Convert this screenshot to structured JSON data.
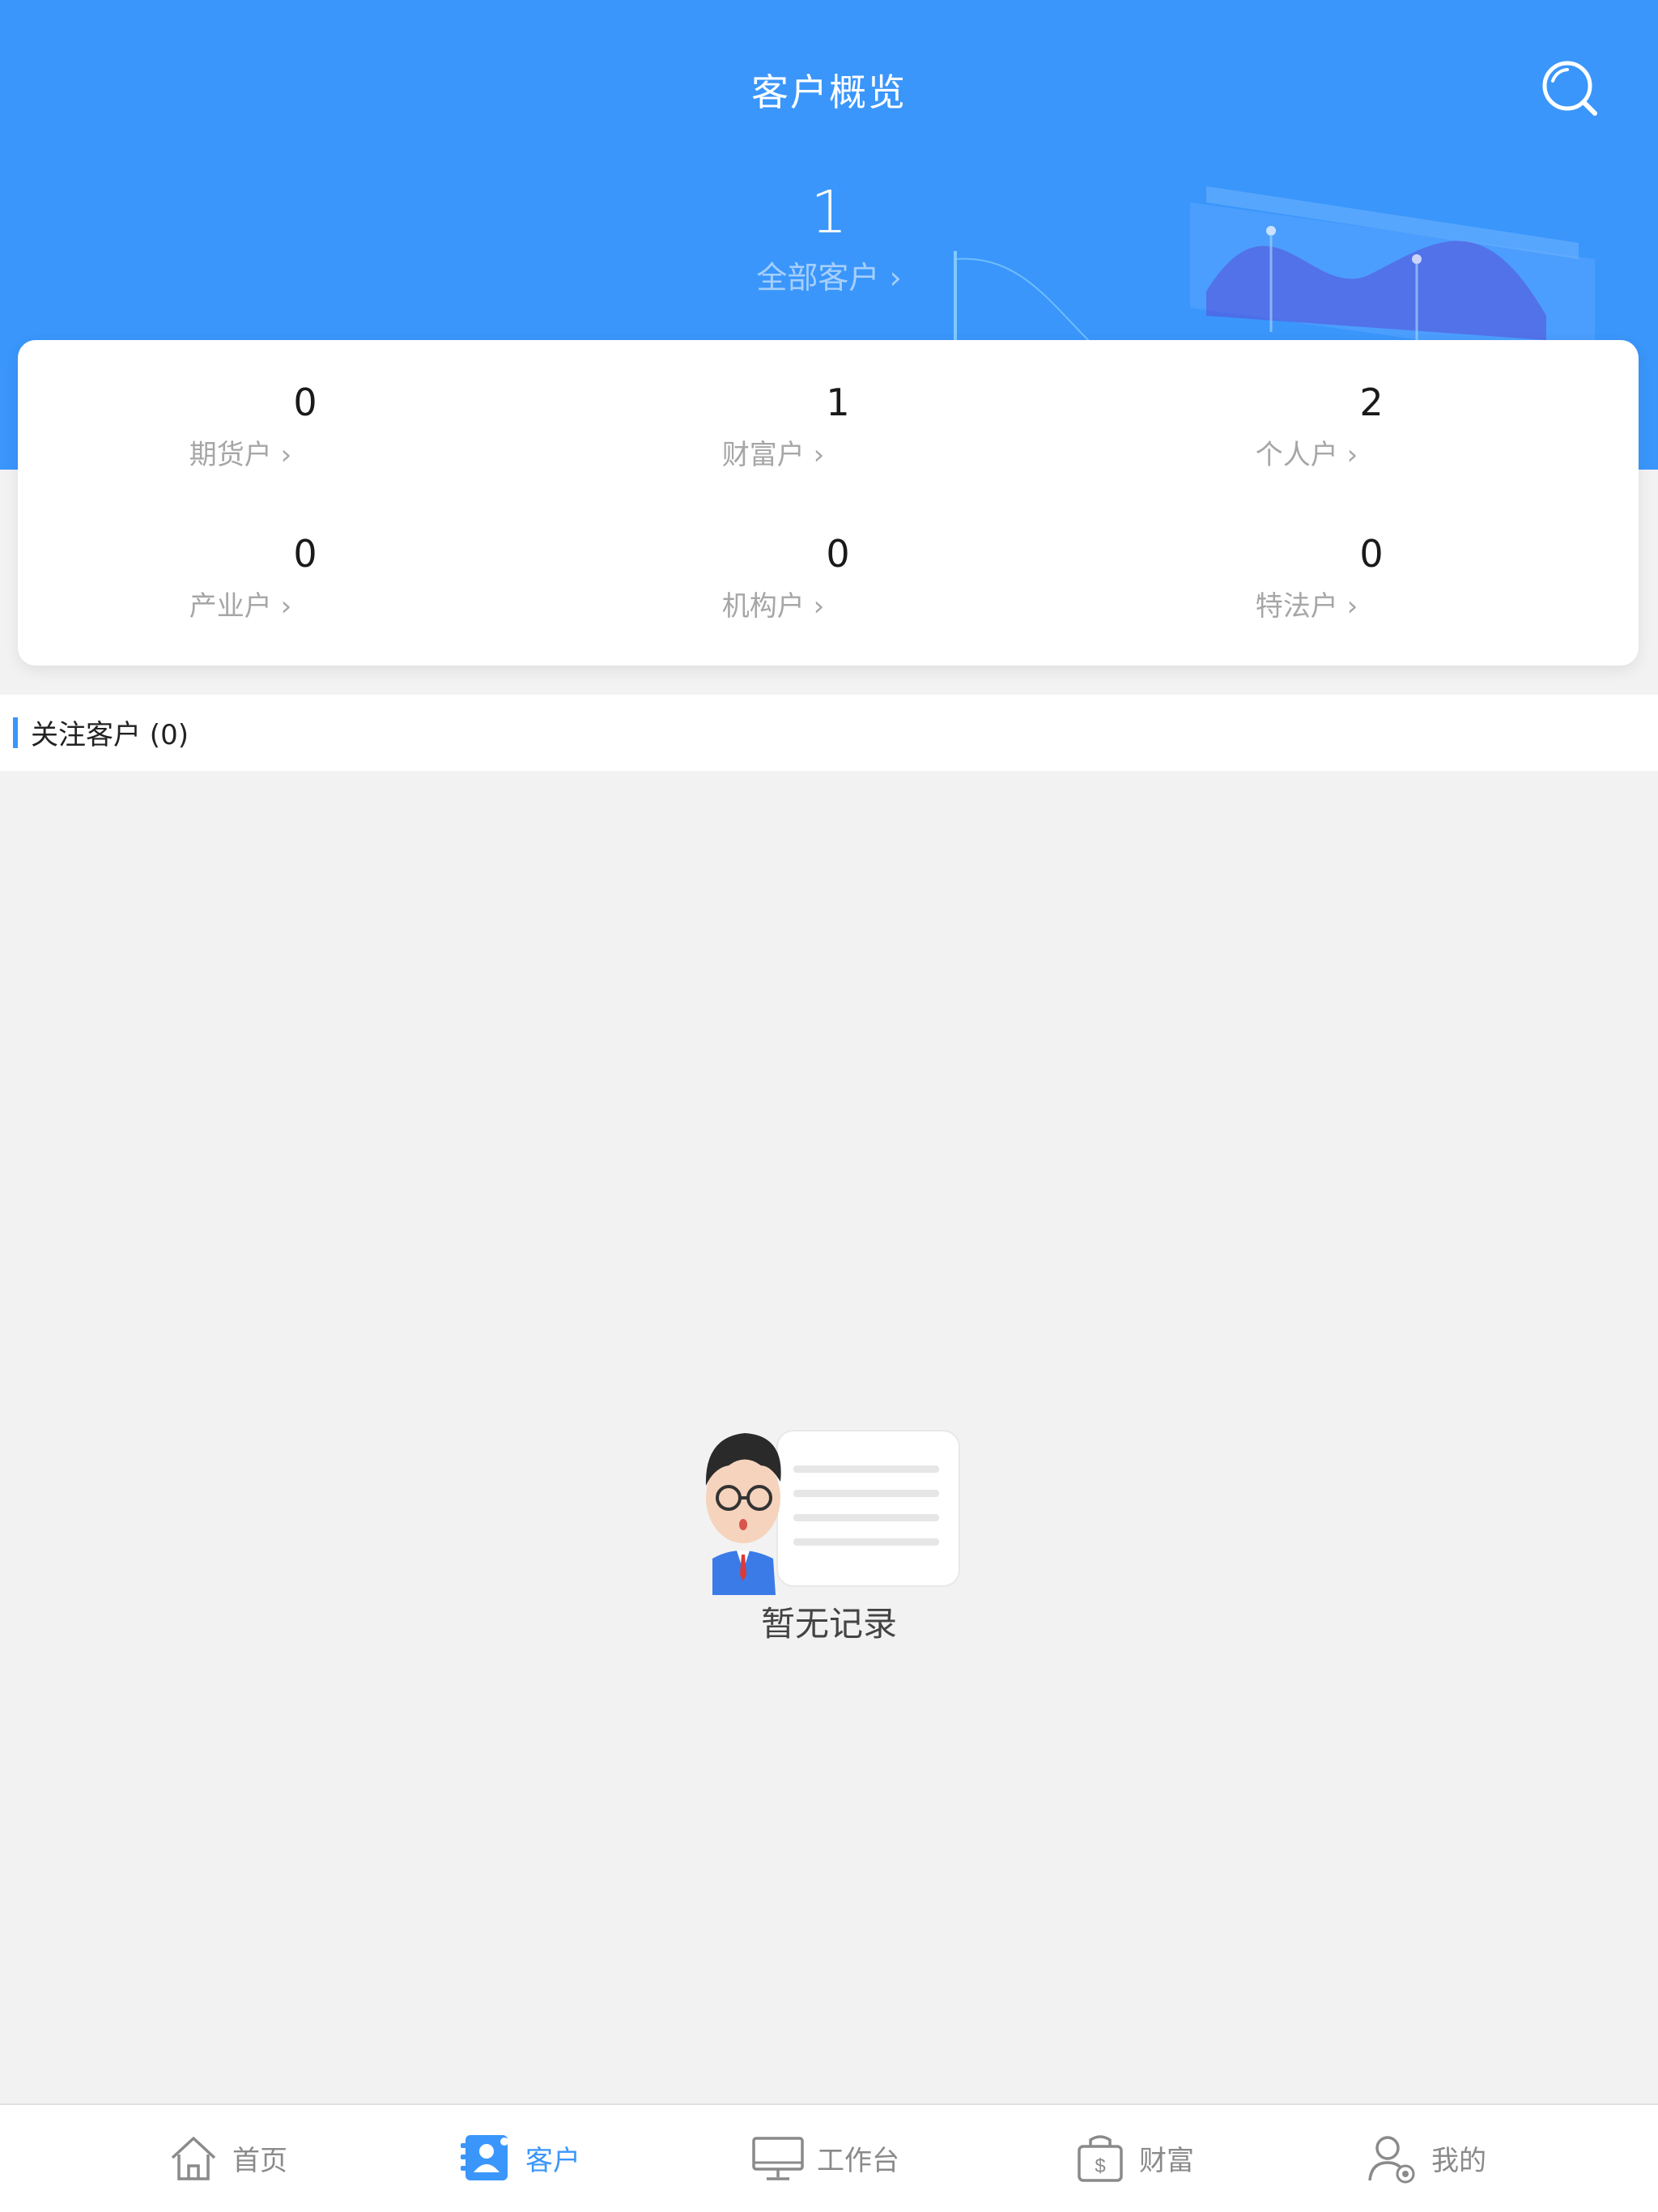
{
  "header": {
    "title": "客户概览",
    "total_count": "1",
    "total_label": "全部客户 ›"
  },
  "stats": [
    {
      "value": "0",
      "label": "期货户 ›"
    },
    {
      "value": "1",
      "label": "财富户 ›"
    },
    {
      "value": "2",
      "label": "个人户 ›"
    },
    {
      "value": "0",
      "label": "产业户 ›"
    },
    {
      "value": "0",
      "label": "机构户 ›"
    },
    {
      "value": "0",
      "label": "特法户 ›"
    }
  ],
  "section": {
    "title": "关注客户 (0)"
  },
  "empty": {
    "text": "暂无记录"
  },
  "tabbar": [
    {
      "label": "首页",
      "icon": "home-icon"
    },
    {
      "label": "客户",
      "icon": "customer-icon",
      "active": true
    },
    {
      "label": "工作台",
      "icon": "monitor-icon"
    },
    {
      "label": "财富",
      "icon": "wallet-icon"
    },
    {
      "label": "我的",
      "icon": "user-icon"
    }
  ],
  "colors": {
    "primary": "#3a96fb",
    "background": "#f2f2f2"
  }
}
